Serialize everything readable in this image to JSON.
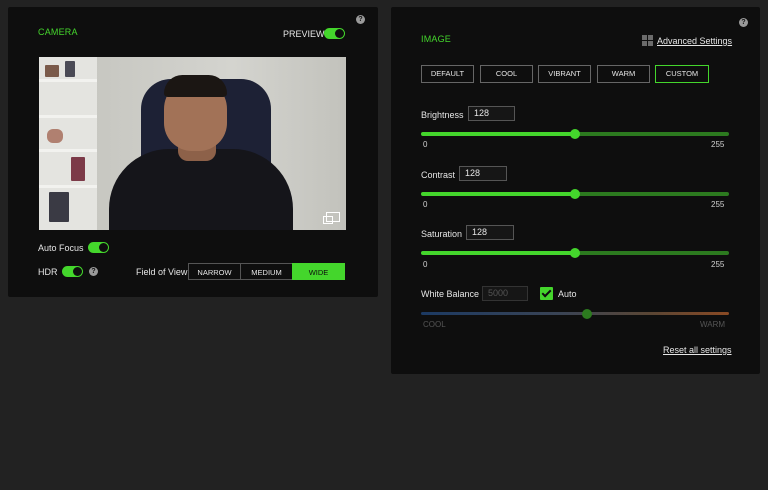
{
  "camera": {
    "title": "CAMERA",
    "preview_label": "PREVIEW",
    "preview_on": true,
    "auto_focus_label": "Auto Focus",
    "auto_focus_on": true,
    "hdr_label": "HDR",
    "hdr_on": true,
    "fov_label": "Field of View",
    "fov_options": [
      "NARROW",
      "MEDIUM",
      "WIDE"
    ],
    "fov_selected": "WIDE"
  },
  "image": {
    "title": "IMAGE",
    "advanced_settings_label": "Advanced Settings",
    "presets": [
      "DEFAULT",
      "COOL",
      "VIBRANT",
      "WARM",
      "CUSTOM"
    ],
    "preset_selected": "CUSTOM",
    "brightness": {
      "label": "Brightness",
      "value": "128",
      "min": "0",
      "max": "255"
    },
    "contrast": {
      "label": "Contrast",
      "value": "128",
      "min": "0",
      "max": "255"
    },
    "saturation": {
      "label": "Saturation",
      "value": "128",
      "min": "0",
      "max": "255"
    },
    "white_balance": {
      "label": "White Balance",
      "value": "5000",
      "auto_label": "Auto",
      "auto_checked": true,
      "min_label": "COOL",
      "max_label": "WARM",
      "position_fraction": 0.54
    },
    "reset_label": "Reset all settings"
  },
  "colors": {
    "accent": "#44d62c",
    "panel": "#0e0e0e",
    "background": "#222222"
  }
}
